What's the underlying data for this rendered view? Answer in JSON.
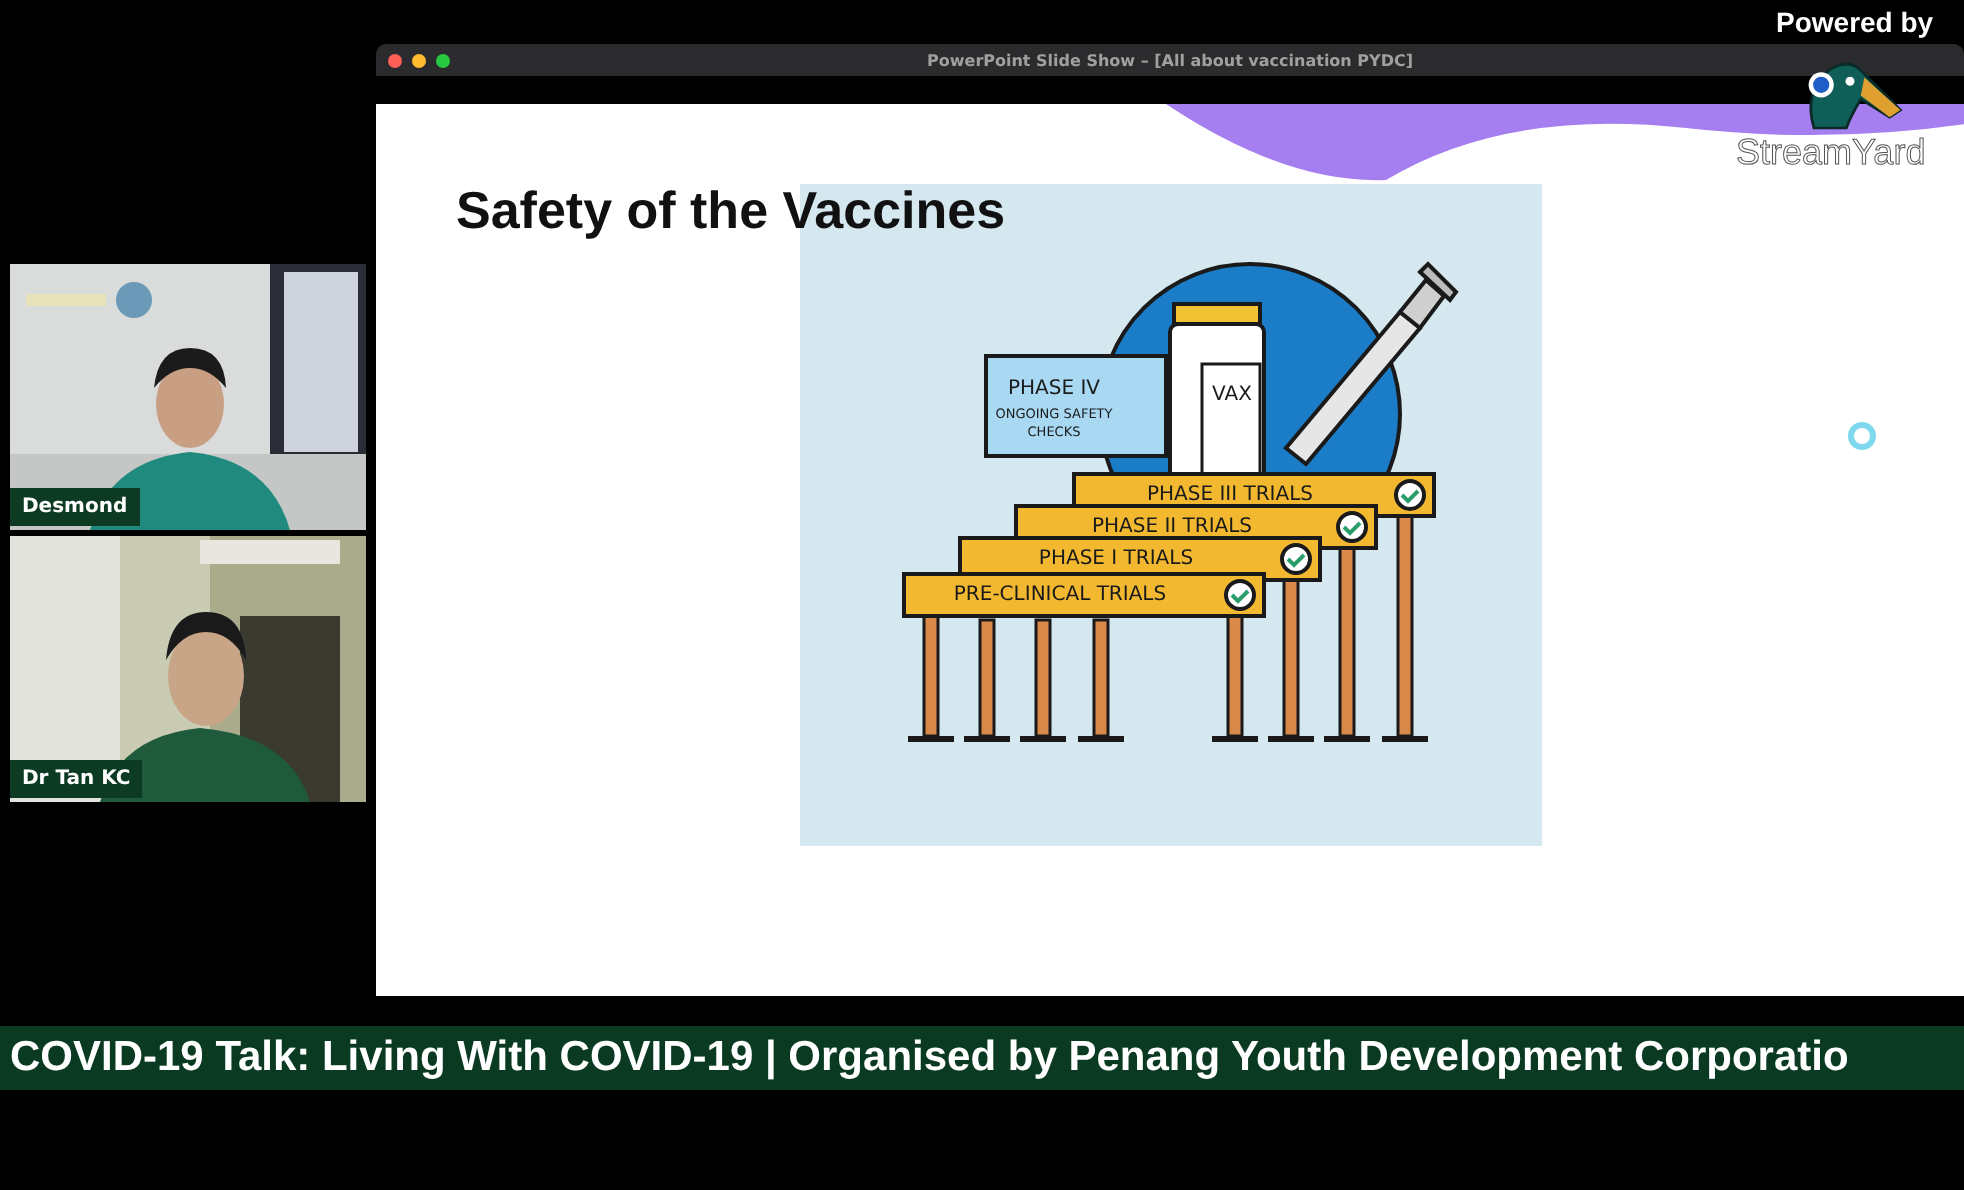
{
  "window": {
    "title": "PowerPoint Slide Show – [All about vaccination PYDC]"
  },
  "branding": {
    "caption": "Powered by",
    "logo_text": "StreamYard"
  },
  "participants": [
    {
      "name": "Desmond",
      "kind": "picture"
    },
    {
      "name": "Dr Tan KC",
      "kind": "picture"
    }
  ],
  "slide": {
    "title": "Safety of the Vaccines",
    "illustration": {
      "phase_iv_title": "PHASE IV",
      "phase_iv_lines": [
        "ONGOING SAFETY",
        "CHECKS"
      ],
      "vial_label": "VAX",
      "signs": [
        {
          "label": "PHASE III TRIALS",
          "checked": true
        },
        {
          "label": "PHASE II TRIALS",
          "checked": true
        },
        {
          "label": "PHASE I TRIALS",
          "checked": true
        },
        {
          "label": "PRE-CLINICAL TRIALS",
          "checked": true
        }
      ]
    }
  },
  "banner": "COVID-19 Talk: Living With COVID-19 | Organised by Penang Youth Development Corporatio"
}
